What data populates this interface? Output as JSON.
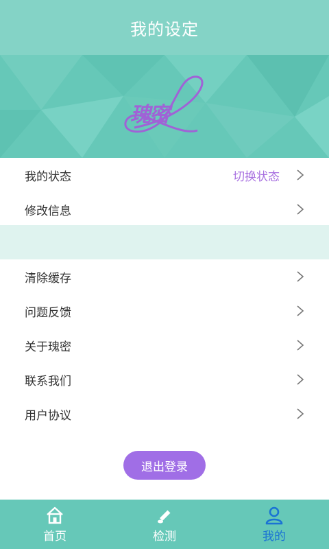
{
  "header": {
    "title": "我的设定"
  },
  "logo": {
    "text": "瑰密"
  },
  "menu_top": [
    {
      "label": "我的状态",
      "value": "切换状态"
    },
    {
      "label": "修改信息",
      "value": ""
    }
  ],
  "menu_bottom": [
    {
      "label": "清除缓存"
    },
    {
      "label": "问题反馈"
    },
    {
      "label": "关于瑰密"
    },
    {
      "label": "联系我们"
    },
    {
      "label": "用户协议"
    }
  ],
  "logout": {
    "label": "退出登录"
  },
  "tabbar": {
    "tabs": [
      {
        "label": "首页",
        "icon": "home-icon"
      },
      {
        "label": "检测",
        "icon": "test-strip-icon"
      },
      {
        "label": "我的",
        "icon": "user-icon",
        "active": true
      }
    ]
  },
  "colors": {
    "header": "#84d3c6",
    "banner": "#66c8b8",
    "accent": "#a06ee6",
    "active_tab": "#1a73d4",
    "gap": "#dff3ef"
  }
}
